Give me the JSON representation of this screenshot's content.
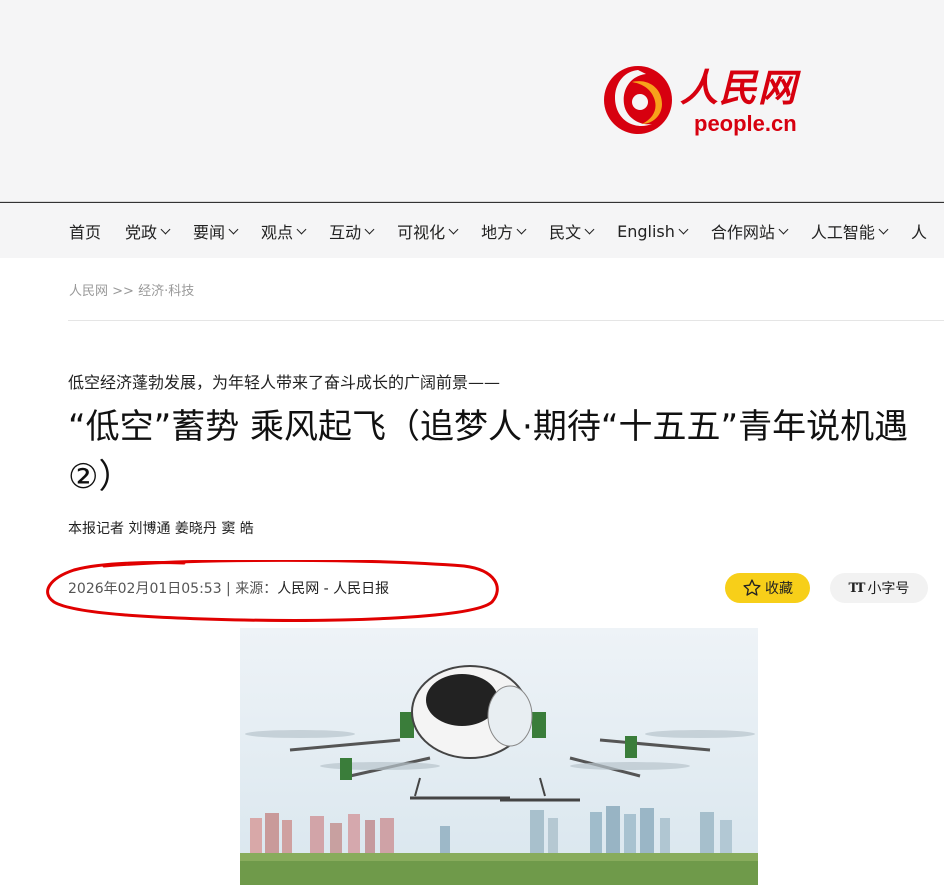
{
  "header": {
    "logo_cn": "人民网",
    "logo_en": "people.cn"
  },
  "nav": {
    "items": [
      {
        "label": "首页",
        "chevron": false
      },
      {
        "label": "党政",
        "chevron": true
      },
      {
        "label": "要闻",
        "chevron": true
      },
      {
        "label": "观点",
        "chevron": true
      },
      {
        "label": "互动",
        "chevron": true
      },
      {
        "label": "可视化",
        "chevron": true
      },
      {
        "label": "地方",
        "chevron": true
      },
      {
        "label": "民文",
        "chevron": true
      },
      {
        "label": "English",
        "chevron": true
      },
      {
        "label": "合作网站",
        "chevron": true
      },
      {
        "label": "人工智能",
        "chevron": true
      },
      {
        "label": "人",
        "chevron": false
      }
    ]
  },
  "breadcrumb": {
    "home": "人民网",
    "sep": " >> ",
    "section": "经济·科技"
  },
  "article": {
    "subtitle": "低空经济蓬勃发展，为年轻人带来了奋斗成长的广阔前景——",
    "title": "“低空”蓄势 乘风起飞（追梦人·期待“十五五”青年说机遇②）",
    "author": "本报记者 刘博通 姜晓丹 窦 皓",
    "date": "2026年02月01日05:53",
    "meta_sep": " | 来源：",
    "source": "人民网 - 人民日报"
  },
  "actions": {
    "favorite_label": "收藏",
    "font_size_label": "小字号",
    "font_icon_text": "TT"
  },
  "colors": {
    "brand_red": "#d7000f",
    "favorite_yellow": "#f7cf19",
    "annotation_red": "#e00000"
  },
  "icons": {
    "favorite": "star-icon",
    "font_size": "text-size-icon"
  }
}
